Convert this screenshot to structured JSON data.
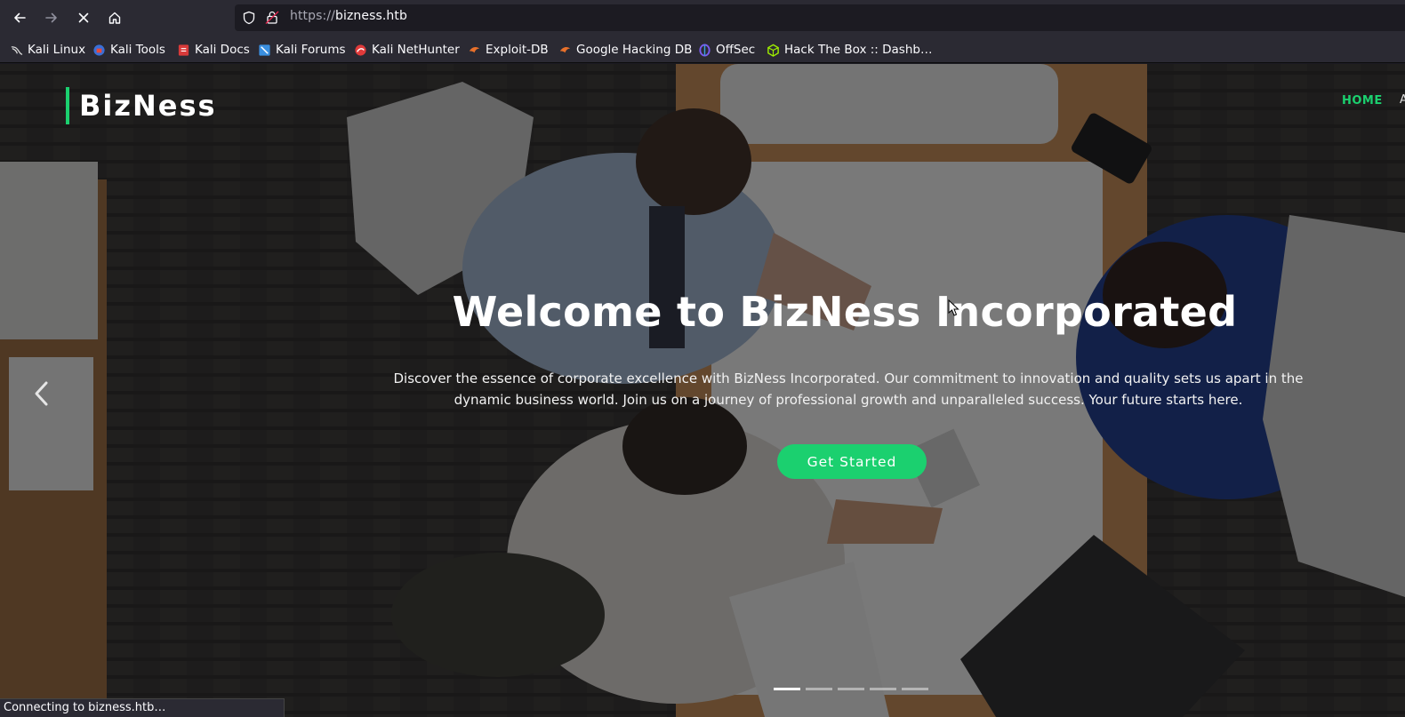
{
  "browser": {
    "url_protocol": "https://",
    "url_host": "bizness.htb",
    "status_text": "Connecting to bizness.htb…"
  },
  "bookmarks": [
    {
      "label": "Kali Linux",
      "icon": "kali-dragon-icon",
      "color": "#d9d9d9"
    },
    {
      "label": "Kali Tools",
      "icon": "kali-tools-icon",
      "color": "#3a6fd8"
    },
    {
      "label": "Kali Docs",
      "icon": "kali-docs-icon",
      "color": "#d83a3a"
    },
    {
      "label": "Kali Forums",
      "icon": "kali-forums-icon",
      "color": "#3a8fe0"
    },
    {
      "label": "Kali NetHunter",
      "icon": "kali-nethunter-icon",
      "color": "#e03a3a"
    },
    {
      "label": "Exploit-DB",
      "icon": "exploit-db-icon",
      "color": "#e8702a"
    },
    {
      "label": "Google Hacking DB",
      "icon": "ghdb-icon",
      "color": "#e8702a"
    },
    {
      "label": "OffSec",
      "icon": "offsec-icon",
      "color": "#7b5cf0"
    },
    {
      "label": "Hack The Box :: Dashb…",
      "icon": "htb-icon",
      "color": "#9fef00"
    }
  ],
  "site": {
    "logo": "BizNess",
    "nav_home": "HOME",
    "nav_more": "A",
    "accent_color": "#1bd06f",
    "hero_title": "Welcome to BizNess Incorporated",
    "hero_description": "Discover the essence of corporate excellence with BizNess Incorporated. Our commitment to innovation and quality sets us apart in the dynamic business world. Join us on a journey of professional growth and unparalleled success. Your future starts here.",
    "cta_label": "Get Started",
    "carousel_slides": 5,
    "carousel_active_index": 0
  }
}
